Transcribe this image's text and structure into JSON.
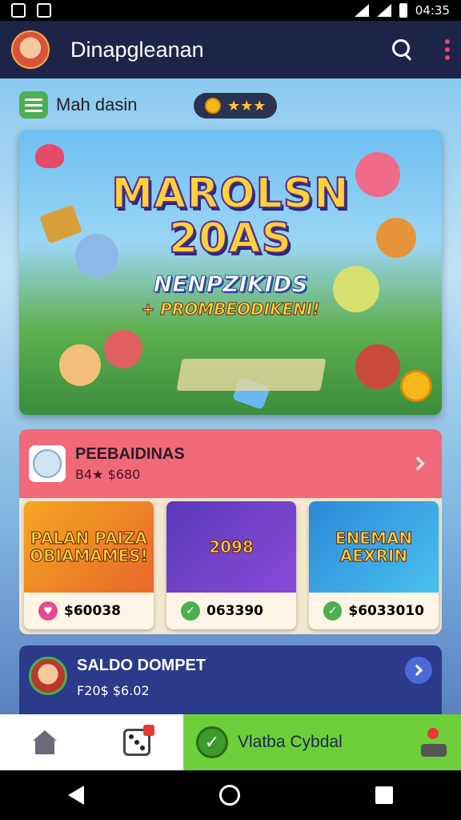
{
  "status_bar": {
    "time": "04:35"
  },
  "app_bar": {
    "title": "Dinapgleanan"
  },
  "subheader": {
    "label": "Mah dasin",
    "rating": "★★★"
  },
  "banner": {
    "title_line1": "MAROLSN",
    "title_line2": "20AS",
    "subtitle": "NENPZIKIDS",
    "tagline": "+ PROMBEODIKENI!"
  },
  "promo": {
    "title": "PEEBAIDINAS",
    "subtitle": "B4★ $680",
    "cards": [
      {
        "art": "PALAN PAIZA OBIAMAMES!",
        "price": "$60038"
      },
      {
        "art": "2098",
        "price": "063390"
      },
      {
        "art": "ENEMAN AEXRIN",
        "price": "$6033010"
      }
    ]
  },
  "wallet": {
    "title": "SALDO DOMPET",
    "amount": "F20$ $6.02"
  },
  "bottom_nav": {
    "action_label": "Vlatba Cybdal"
  },
  "colors": {
    "accent_green": "#6ecf3a",
    "promo_red": "#f26a7a",
    "appbar": "#1e2447",
    "wallet_blue": "#2b3a8a"
  }
}
